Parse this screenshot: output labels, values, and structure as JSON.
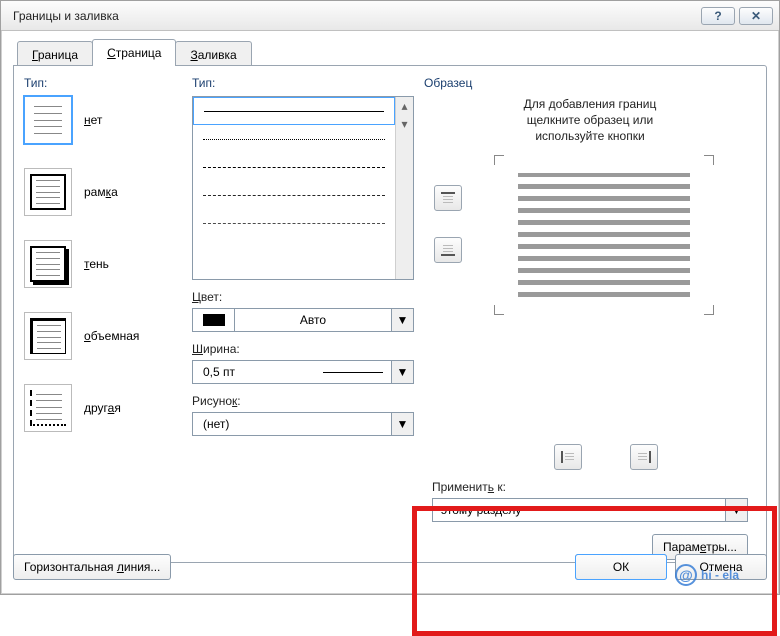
{
  "window": {
    "title": "Границы и заливка"
  },
  "tabs": {
    "border": {
      "pre": "",
      "mn": "Г",
      "post": "раница"
    },
    "page": {
      "pre": "",
      "mn": "С",
      "post": "траница"
    },
    "shading": {
      "pre": "",
      "mn": "З",
      "post": "аливка"
    }
  },
  "colA": {
    "label": "Тип:",
    "presets": [
      {
        "pre": "",
        "mn": "н",
        "post": "ет"
      },
      {
        "pre": "рам",
        "mn": "к",
        "post": "а"
      },
      {
        "pre": "",
        "mn": "т",
        "post": "ень"
      },
      {
        "pre": "",
        "mn": "о",
        "post": "бъемная"
      },
      {
        "pre": "друг",
        "mn": "а",
        "post": "я"
      }
    ]
  },
  "colB": {
    "type_label": "Тип:",
    "color_label": {
      "pre": "",
      "mn": "Ц",
      "post": "вет:"
    },
    "color_value": "Авто",
    "width_label": {
      "pre": "",
      "mn": "Ш",
      "post": "ирина:"
    },
    "width_value": "0,5 пт",
    "art_label": {
      "pre": "Рисуно",
      "mn": "к",
      "post": ":"
    },
    "art_value": "(нет)"
  },
  "colC": {
    "label": "Образец",
    "hint_l1": "Для добавления границ",
    "hint_l2": "щелкните образец или",
    "hint_l3": "используйте кнопки",
    "apply_label": {
      "pre": "Применит",
      "mn": "ь",
      "post": " к:"
    },
    "apply_value": "этому разделу",
    "params_btn": {
      "pre": "Парам",
      "mn": "е",
      "post": "тры..."
    }
  },
  "bottom": {
    "hline_btn": {
      "pre": "Горизонтальная ",
      "mn": "л",
      "post": "иния..."
    },
    "ok": "ОК",
    "cancel": "Отмена"
  },
  "watermark": "hi -      ela"
}
